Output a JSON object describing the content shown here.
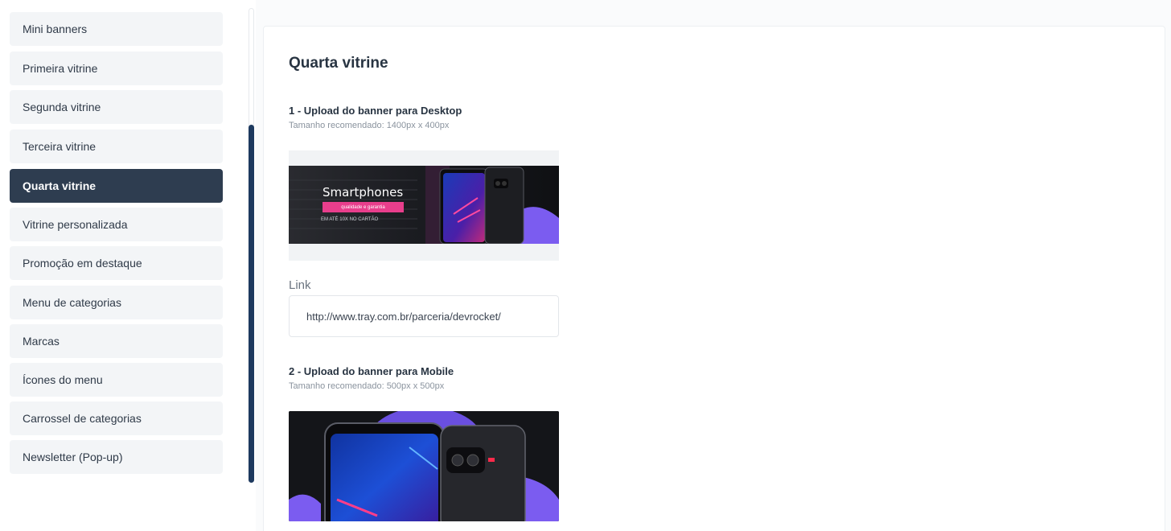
{
  "sidebar": {
    "items": [
      {
        "label": "Mini banners",
        "active": false
      },
      {
        "label": "Primeira vitrine",
        "active": false
      },
      {
        "label": "Segunda vitrine",
        "active": false
      },
      {
        "label": "Terceira vitrine",
        "active": false
      },
      {
        "label": "Quarta vitrine",
        "active": true
      },
      {
        "label": "Vitrine personalizada",
        "active": false
      },
      {
        "label": "Promoção em destaque",
        "active": false
      },
      {
        "label": "Menu de categorias",
        "active": false
      },
      {
        "label": "Marcas",
        "active": false
      },
      {
        "label": "Ícones do menu",
        "active": false
      },
      {
        "label": "Carrossel de categorias",
        "active": false
      },
      {
        "label": "Newsletter (Pop-up)",
        "active": false
      }
    ]
  },
  "main": {
    "title": "Quarta vitrine",
    "desktop": {
      "heading": "1 - Upload do banner para Desktop",
      "hint": "Tamanho recomendado: 1400px x 400px",
      "banner": {
        "title": "Smartphones",
        "tag": "qualidade e garantia",
        "subtitle": "EM ATÉ 10X NO CARTÃO"
      }
    },
    "link": {
      "label": "Link",
      "value": "http://www.tray.com.br/parceria/devrocket/"
    },
    "mobile": {
      "heading": "2 - Upload do banner para Mobile",
      "hint": "Tamanho recomendado: 500px x 500px"
    }
  },
  "colors": {
    "active_item_bg": "#2e3d50",
    "scroll_thumb": "#1e3a5f",
    "accent_pink": "#e83e8c",
    "accent_purple": "#7b5cf0"
  }
}
